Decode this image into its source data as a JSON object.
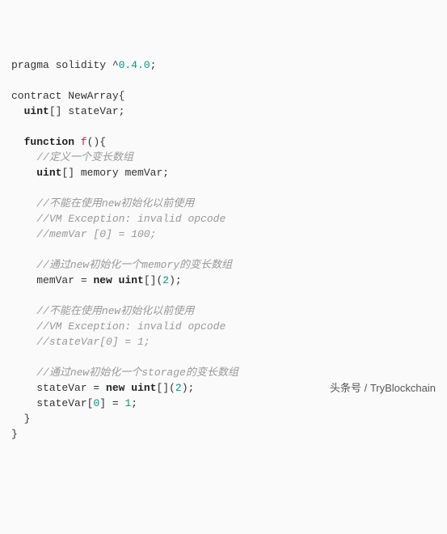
{
  "code": {
    "line1_pragma": "pragma solidity ^",
    "line1_ver": "0.4.0",
    "line1_end": ";",
    "line3": "contract NewArray{",
    "line4_kw": "uint",
    "line4_rest": "[] stateVar;",
    "line6_kw": "function",
    "line6_fn": "f",
    "line6_rest": "(){",
    "c1": "//定义一个变长数组",
    "line8_kw": "uint",
    "line8_rest": "[] memory memVar;",
    "c2": "//不能在使用new初始化以前使用",
    "c3": "//VM Exception: invalid opcode",
    "c4": "//memVar [0] = 100;",
    "c5": "//通过new初始化一个memory的变长数组",
    "line15_a": "memVar = ",
    "line15_new": "new",
    "line15_sp": " ",
    "line15_uint": "uint",
    "line15_b": "[](",
    "line15_num": "2",
    "line15_c": ");",
    "c6": "//不能在使用new初始化以前使用",
    "c7": "//VM Exception: invalid opcode",
    "c8": "//stateVar[0] = 1;",
    "c9": "//通过new初始化一个storage的变长数组",
    "line22_a": "stateVar = ",
    "line22_new": "new",
    "line22_sp": " ",
    "line22_uint": "uint",
    "line22_b": "[](",
    "line22_num": "2",
    "line22_c": ");",
    "line23_a": "stateVar[",
    "line23_idx": "0",
    "line23_b": "] = ",
    "line23_val": "1",
    "line23_c": ";",
    "close_fn": "}",
    "close_ct": "}"
  },
  "watermark": "头条号 / TryBlockchain"
}
